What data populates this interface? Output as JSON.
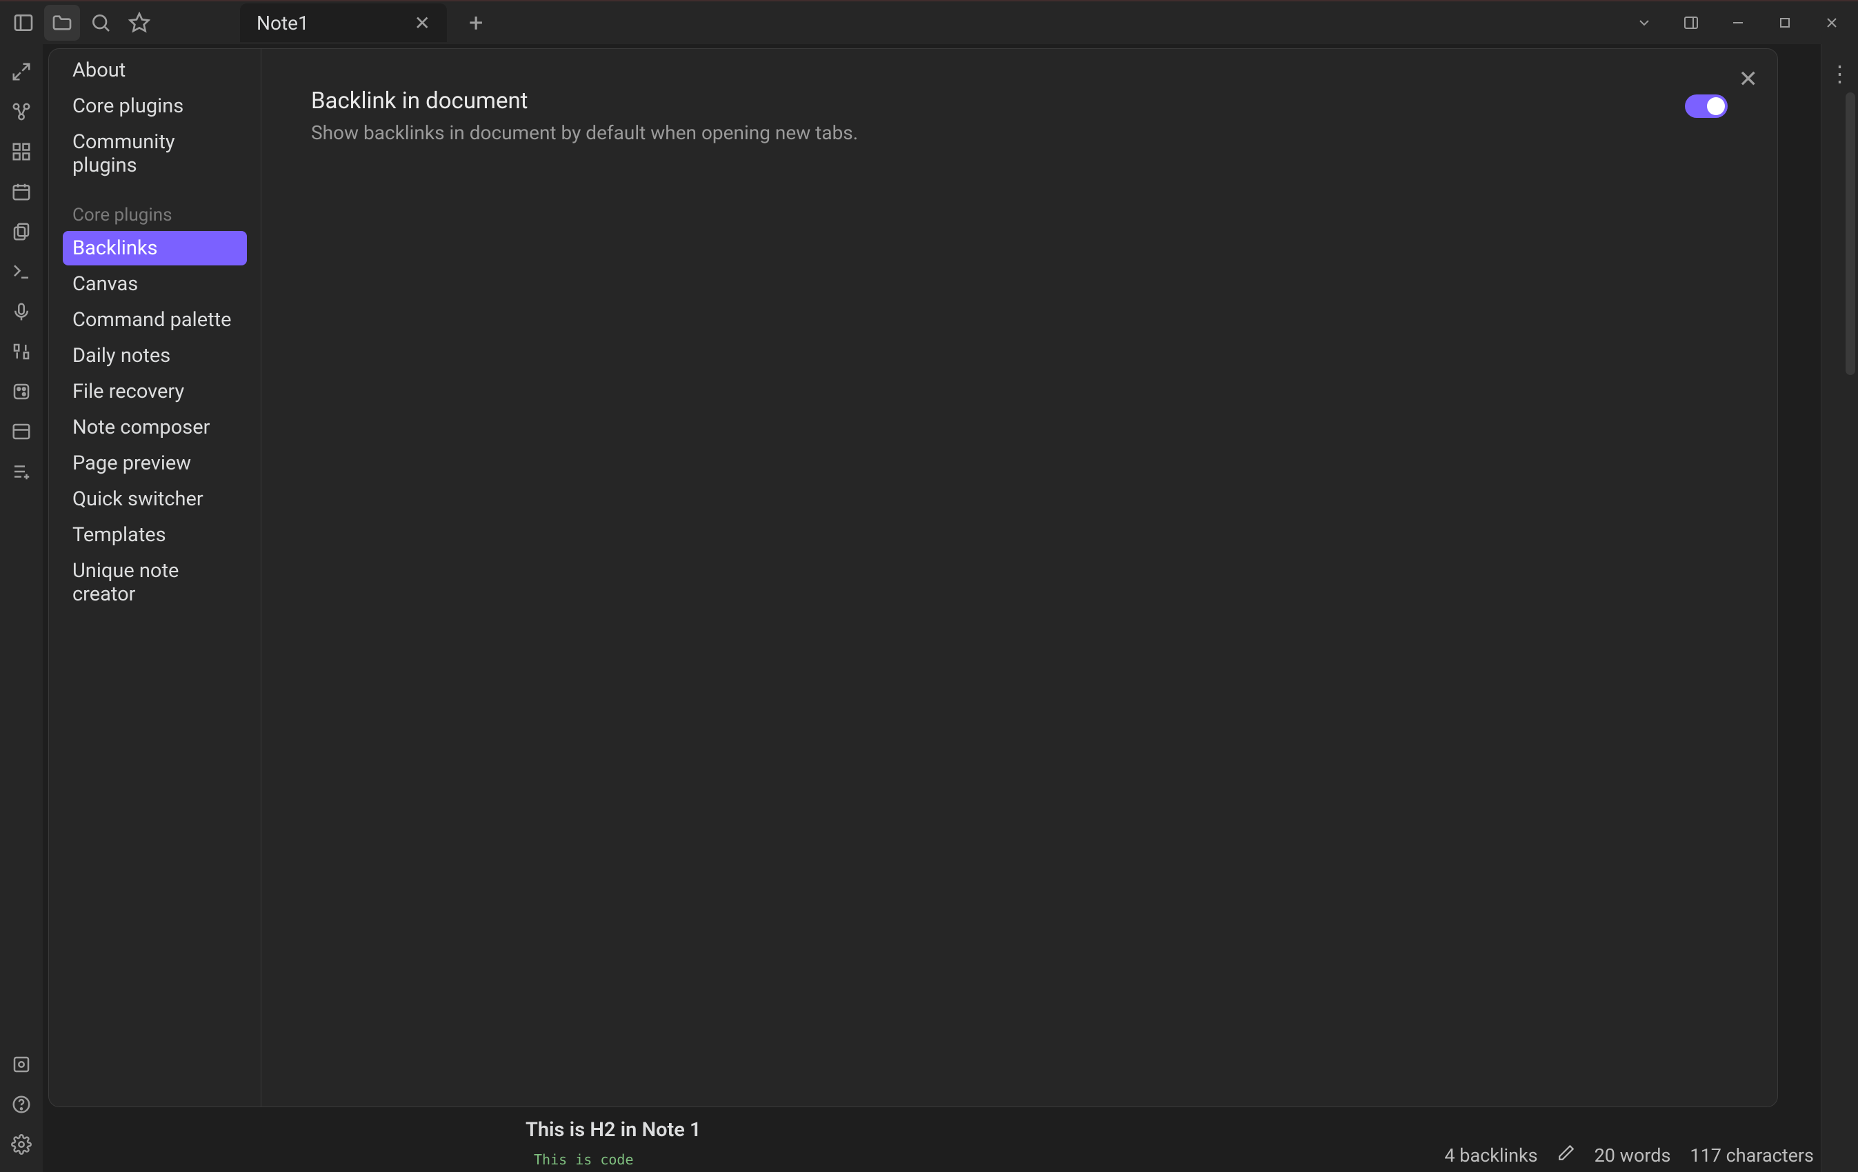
{
  "tab": {
    "title": "Note1"
  },
  "settings": {
    "nav_top": [
      "About",
      "Core plugins",
      "Community plugins"
    ],
    "section_heading": "Core plugins",
    "nav_plugins": [
      "Backlinks",
      "Canvas",
      "Command palette",
      "Daily notes",
      "File recovery",
      "Note composer",
      "Page preview",
      "Quick switcher",
      "Templates",
      "Unique note creator"
    ],
    "selected_index": 0,
    "pane": {
      "title": "Backlink in document",
      "description": "Show backlinks in document by default when opening new tabs.",
      "toggle_on": true
    }
  },
  "background_doc": {
    "heading": "This is H2 in Note 1",
    "code": "This is code"
  },
  "status": {
    "backlinks": "4 backlinks",
    "words": "20 words",
    "chars": "117 characters"
  }
}
